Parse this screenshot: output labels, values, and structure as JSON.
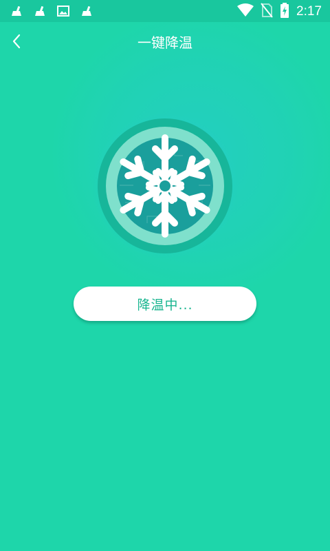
{
  "status_bar": {
    "time": "2:17",
    "left_icons": [
      "broom-icon",
      "broom-icon",
      "image-icon",
      "broom-icon"
    ],
    "right_icons": [
      "wifi-icon",
      "no-sim-icon",
      "battery-charging-icon"
    ]
  },
  "header": {
    "title": "一键降温",
    "back_icon": "chevron-left-icon"
  },
  "main": {
    "hero_icon": "snowflake-icon",
    "action_label": "降温中..."
  },
  "colors": {
    "background": "#1ed6aa",
    "status_bar": "#19c79e",
    "ring_outer": "#17b69a",
    "ring_inner": "#7fe0cc",
    "disc": "#1a9f9c",
    "button_text": "#18b58f"
  }
}
